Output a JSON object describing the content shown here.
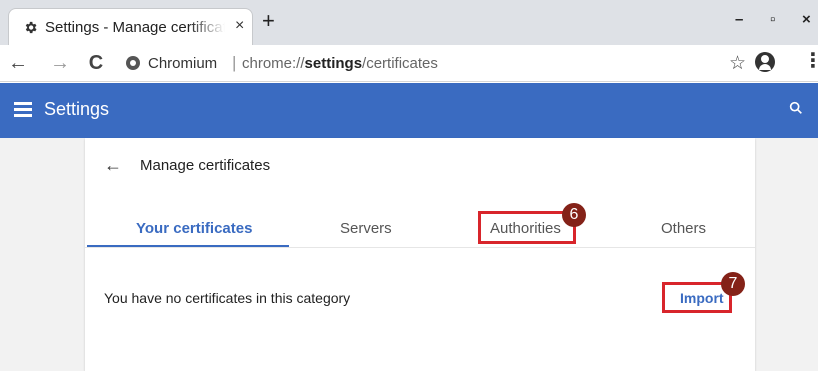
{
  "browser": {
    "tab_title": "Settings - Manage certificates",
    "tab_close": "×",
    "new_tab": "+",
    "minimize": "–",
    "maximize": "▫",
    "close": "×",
    "site_name": "Chromium",
    "url_prefix": "chrome://",
    "url_bold": "settings",
    "url_suffix": "/certificates",
    "icons": [
      "back-icon",
      "forward-icon",
      "reload-icon",
      "star-icon",
      "profile-icon",
      "kebab-menu-icon"
    ]
  },
  "settings": {
    "header_title": "Settings",
    "page_title": "Manage certificates",
    "tabs": [
      {
        "label": "Your certificates"
      },
      {
        "label": "Servers"
      },
      {
        "label": "Authorities"
      },
      {
        "label": "Others"
      }
    ],
    "active_tab": "Your certificates",
    "empty_message": "You have no certificates in this category",
    "import_label": "Import"
  },
  "annotations": {
    "step_authorities": "6",
    "step_import": "7",
    "highlight_color": "#d8252b",
    "badge_color": "#842218"
  },
  "colors": {
    "accent": "#3a6bc1"
  }
}
